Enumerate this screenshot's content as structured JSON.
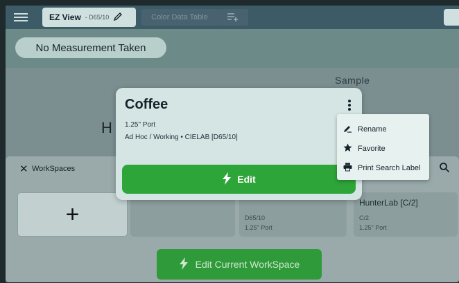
{
  "topbar": {
    "tab_ez": {
      "label": "EZ View",
      "sub": "- D65/10",
      "pen_icon": "pencil-icon"
    },
    "tab_color_table": {
      "label": "Color Data Table"
    },
    "add_tab_icon": "playlist-add-icon"
  },
  "measurement": {
    "label": "No Measurement Taken"
  },
  "background": {
    "sample": "Sample",
    "big_letter": "H"
  },
  "workspaces": {
    "title": "WorkSpaces",
    "close_icon": "close-icon",
    "search_icon": "search-icon",
    "add_icon": "+",
    "cards": [
      {
        "title": "",
        "line1": "",
        "line2": ""
      },
      {
        "title": "",
        "line1": "D65/10",
        "line2": "1.25\" Port"
      },
      {
        "title": "HunterLab [C/2]",
        "line1": "C/2",
        "line2": "1.25\" Port"
      }
    ],
    "edit_current": "Edit Current WorkSpace"
  },
  "modal": {
    "title": "Coffee",
    "line1": "1.25\" Port",
    "line2": "Ad Hoc / Working  •  CIELAB [D65/10]",
    "edit_label": "Edit"
  },
  "menu": {
    "items": [
      {
        "label": "Rename",
        "icon": "rename-icon"
      },
      {
        "label": "Favorite",
        "icon": "star-icon"
      },
      {
        "label": "Print Search Label",
        "icon": "printer-icon"
      }
    ]
  },
  "colors": {
    "primary_green": "#2ea538",
    "topbar": "#3d5a67",
    "surface": "#d5e5e4"
  }
}
